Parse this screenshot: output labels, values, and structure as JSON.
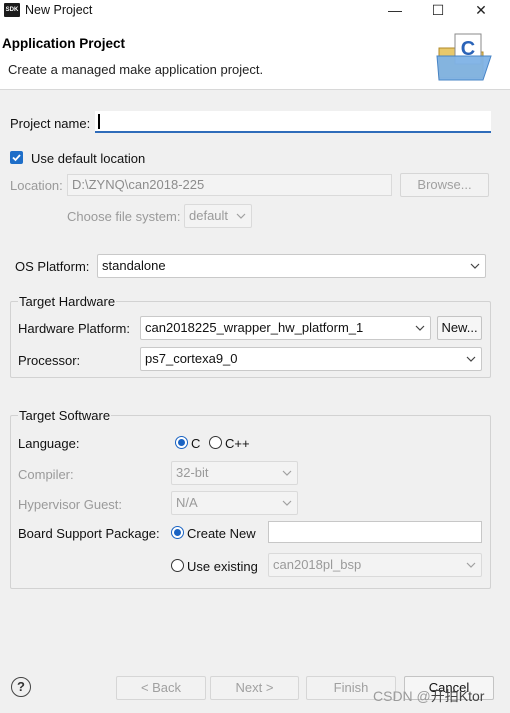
{
  "window": {
    "title": "New Project",
    "app_icon_text": "SDK",
    "controls": {
      "minimize": "—",
      "maximize": "☐",
      "close": "✕"
    }
  },
  "header": {
    "title": "Application Project",
    "description": "Create a managed make application project."
  },
  "project": {
    "name_label": "Project name:",
    "name_value": "",
    "use_default_location_label": "Use default location",
    "use_default_location_checked": true,
    "location_label": "Location:",
    "location_value": "D:\\ZYNQ\\can2018-225",
    "browse_label": "Browse...",
    "file_system_label": "Choose file system:",
    "file_system_value": "default"
  },
  "os_platform": {
    "label": "OS Platform:",
    "value": "standalone"
  },
  "target_hardware": {
    "title": "Target Hardware",
    "hardware_platform_label": "Hardware Platform:",
    "hardware_platform_value": "can2018225_wrapper_hw_platform_1",
    "new_button": "New...",
    "processor_label": "Processor:",
    "processor_value": "ps7_cortexa9_0"
  },
  "target_software": {
    "title": "Target Software",
    "language_label": "Language:",
    "language_options": [
      "C",
      "C++"
    ],
    "language_selected": "C",
    "compiler_label": "Compiler:",
    "compiler_value": "32-bit",
    "hypervisor_label": "Hypervisor Guest:",
    "hypervisor_value": "N/A",
    "bsp_label": "Board Support Package:",
    "bsp_create_new_label": "Create New",
    "bsp_create_new_value": "",
    "bsp_use_existing_label": "Use existing",
    "bsp_use_existing_value": "can2018pl_bsp",
    "bsp_selected": "Create New"
  },
  "footer": {
    "help": "?",
    "back": "< Back",
    "next": "Next >",
    "finish": "Finish",
    "cancel": "Cancel"
  },
  "watermark": {
    "prefix": "CSDN @",
    "name": "开拍Ktor"
  },
  "colors": {
    "accent": "#1e6ec8",
    "focus_underline": "#2f6cba",
    "disabled_text": "#9a9a9a"
  }
}
